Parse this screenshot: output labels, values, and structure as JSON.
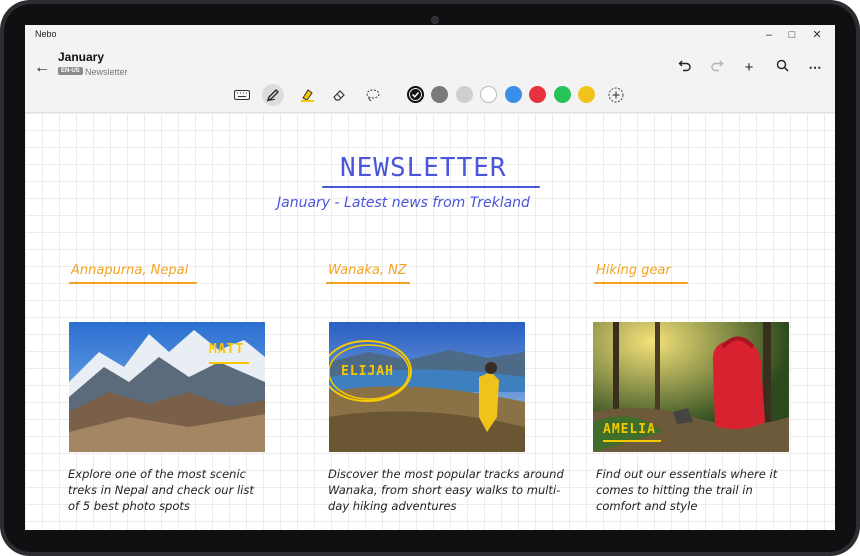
{
  "window": {
    "app_name": "Nebo",
    "controls": [
      "minimize-icon",
      "maximize-icon",
      "close-icon"
    ]
  },
  "header": {
    "title": "January",
    "language_badge": "EN-US",
    "subtitle": "Newsletter"
  },
  "actions": [
    "undo-icon",
    "redo-icon",
    "add-icon",
    "search-icon",
    "more-icon"
  ],
  "toolbar": {
    "tools": [
      "keyboard-icon",
      "pen-icon",
      "highlighter-icon",
      "eraser-icon",
      "lasso-icon"
    ],
    "active_tool": "pen-icon",
    "colors": [
      "#111111",
      "#7a7a7a",
      "#cfcfcf",
      "#ffffff",
      "#3b8ee8",
      "#e5323d",
      "#27c25a",
      "#f2c21c"
    ],
    "selected_color": "#111111"
  },
  "page": {
    "title": "NEWSLETTER",
    "subtitle": "January - Latest news from Trekland",
    "sections": [
      {
        "title": "Annapurna, Nepal",
        "tag": "MATT",
        "description": "Explore one of the most scenic treks in Nepal and check our list of 5 best photo spots"
      },
      {
        "title": "Wanaka, NZ",
        "tag": "ELIJAH",
        "description": "Discover the most popular tracks around Wanaka, from short easy walks to multi-day hiking adventures"
      },
      {
        "title": "Hiking gear",
        "tag": "AMELIA",
        "description": "Find out our essentials where it comes to hitting the trail in comfort and style"
      }
    ]
  },
  "colors": {
    "title_ink": "#4a55d9",
    "section_ink": "#f4a321",
    "tag_ink": "#f7c800"
  }
}
